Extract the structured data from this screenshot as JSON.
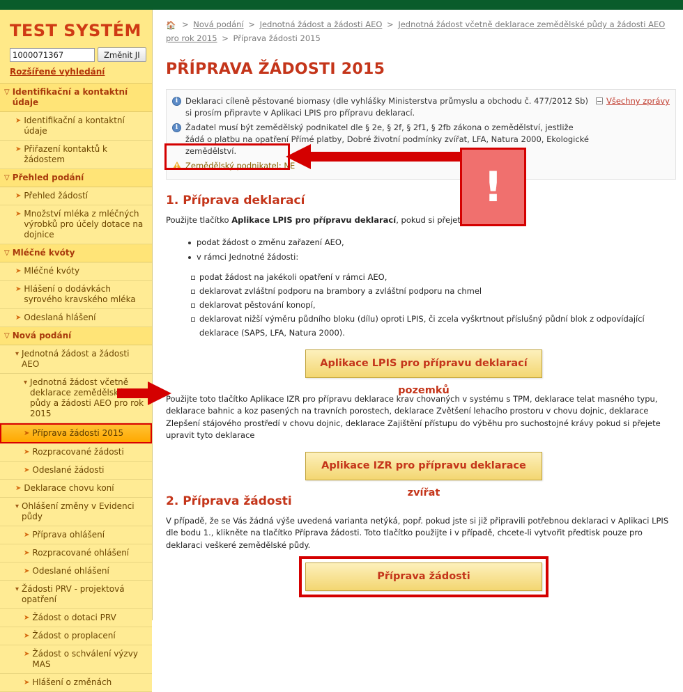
{
  "topbar": {
    "color": "#0a5c2b"
  },
  "sidebar": {
    "brand": "TEST SYSTÉM",
    "ji_value": "1000071367",
    "ji_placeholder": "",
    "ji_button": "Změnit JI",
    "advanced_link": "Rozšířené vyhledání",
    "items": [
      {
        "type": "group",
        "label": "Identifikační a kontaktní údaje",
        "icon": "chevron-down-icon"
      },
      {
        "type": "item",
        "level": 1,
        "label": "Identifikační a kontaktní údaje"
      },
      {
        "type": "item",
        "level": 1,
        "label": "Přiřazení kontaktů k žádostem"
      },
      {
        "type": "group",
        "label": "Přehled podání",
        "icon": "chevron-down-icon"
      },
      {
        "type": "item",
        "level": 1,
        "label": "Přehled žádostí"
      },
      {
        "type": "item",
        "level": 1,
        "label": "Množství mléka z mléčných výrobků pro účely dotace na dojnice"
      },
      {
        "type": "group",
        "label": "Mléčné kvóty",
        "icon": "chevron-down-icon"
      },
      {
        "type": "item",
        "level": 1,
        "label": "Mléčné kvóty"
      },
      {
        "type": "item",
        "level": 1,
        "label": "Hlášení o dodávkách syrového kravského mléka"
      },
      {
        "type": "item",
        "level": 1,
        "label": "Odeslaná hlášení"
      },
      {
        "type": "group",
        "label": "Nová podání",
        "icon": "chevron-down-icon"
      },
      {
        "type": "expand",
        "level": 1,
        "label": "Jednotná žádost a žádosti AEO"
      },
      {
        "type": "expand",
        "level": 2,
        "label": "Jednotná žádost včetně deklarace zemědělské půdy a žádosti AEO pro rok 2015"
      },
      {
        "type": "active",
        "level": 3,
        "label": "Příprava žádosti 2015"
      },
      {
        "type": "item",
        "level": 3,
        "label": "Rozpracované žádosti"
      },
      {
        "type": "item",
        "level": 3,
        "label": "Odeslané žádosti"
      },
      {
        "type": "item",
        "level": 2,
        "label": "Deklarace chovu koní"
      },
      {
        "type": "expand",
        "level": 1,
        "label": "Ohlášení změny v Evidenci půdy"
      },
      {
        "type": "item",
        "level": 2,
        "label": "Příprava ohlášení"
      },
      {
        "type": "item",
        "level": 2,
        "label": "Rozpracované ohlášení"
      },
      {
        "type": "item",
        "level": 2,
        "label": "Odeslané ohlášení"
      },
      {
        "type": "expand",
        "level": 1,
        "label": "Žádosti PRV - projektová opatření"
      },
      {
        "type": "item",
        "level": 2,
        "label": "Žádost o dotaci PRV"
      },
      {
        "type": "item",
        "level": 2,
        "label": "Žádost o proplacení"
      },
      {
        "type": "item",
        "level": 2,
        "label": "Žádost o schválení výzvy MAS"
      },
      {
        "type": "item",
        "level": 2,
        "label": "Hlášení o změnách"
      }
    ]
  },
  "breadcrumb": {
    "home_icon": "home-icon",
    "separator": ">",
    "items": [
      "Nová podání",
      "Jednotná žádost a žádosti AEO",
      "Jednotná žádost včetně deklarace zemědělské půdy a žádosti AEO pro rok 2015"
    ],
    "current": "Příprava žádosti 2015"
  },
  "page": {
    "title": "PŘÍPRAVA ŽÁDOSTI 2015"
  },
  "messages": {
    "all_messages_label": "Všechny zprávy",
    "items": [
      {
        "icon": "info-icon",
        "text": "Deklaraci cíleně pěstované biomasy (dle vyhlášky Ministerstva průmyslu a obchodu č. 477/2012 Sb) si prosím připravte v Aplikaci LPIS pro přípravu deklarací."
      },
      {
        "icon": "info-icon",
        "text": "Žadatel musí být zemědělský podnikatel dle § 2e, § 2f, § 2f1, § 2fb zákona o zemědělství, jestliže žádá o platbu na opatření Přímé platby, Dobré životní podmínky zvířat, LFA, Natura 2000, Ekologické zemědělství."
      },
      {
        "icon": "warning-icon",
        "text": "Zemědělský podnikatel: NE"
      }
    ]
  },
  "annotations": {
    "exclamation": "!",
    "highlight_color": "#d40000",
    "exclamation_fill": "#f0706e"
  },
  "section1": {
    "title": "1. Příprava deklarací",
    "intro_prefix": "Použijte tlačítko ",
    "intro_bold": "Aplikace LPIS pro přípravu deklarací",
    "intro_suffix": ", pokud si přejete:",
    "bullets": [
      "podat žádost o změnu zařazení AEO,",
      "v rámci Jednotné žádosti:"
    ],
    "subbullets": [
      "podat žádost na jakékoli opatření v rámci AEO,",
      "deklarovat zvláštní podporu na brambory a zvláštní podporu na chmel",
      "deklarovat pěstování konopí,",
      "deklarovat nižší výměru půdního bloku (dílu) oproti LPIS, či zcela vyškrtnout příslušný půdní blok z odpovídající deklarace (SAPS, LFA, Natura 2000)."
    ],
    "lpis_button": "Aplikace LPIS pro přípravu deklarací pozemků",
    "izr_paragraph": "Použijte toto tlačítko Aplikace IZR pro přípravu deklarace krav chovaných v systému s TPM, deklarace telat masného typu, deklarace bahnic a koz pasených na travních porostech, deklarace Zvětšení lehacího prostoru v chovu dojnic, deklarace Zlepšení stájového prostředí v chovu dojnic, deklarace Zajištění přístupu do výběhu pro suchostojné krávy pokud si přejete upravit tyto deklarace",
    "izr_button": "Aplikace IZR pro přípravu deklarace zvířat"
  },
  "section2": {
    "title": "2. Příprava žádosti",
    "paragraph": "V případě, že se Vás žádná výše uvedená varianta netýká, popř. pokud jste si již připravili potřebnou deklaraci v Aplikaci LPIS dle bodu 1., klikněte na tlačítko Příprava žádosti. Toto tlačítko použijte i v případě, chcete-li vytvořit předtisk pouze pro deklaraci veškeré zemědělské půdy.",
    "button": "Příprava žádosti"
  }
}
